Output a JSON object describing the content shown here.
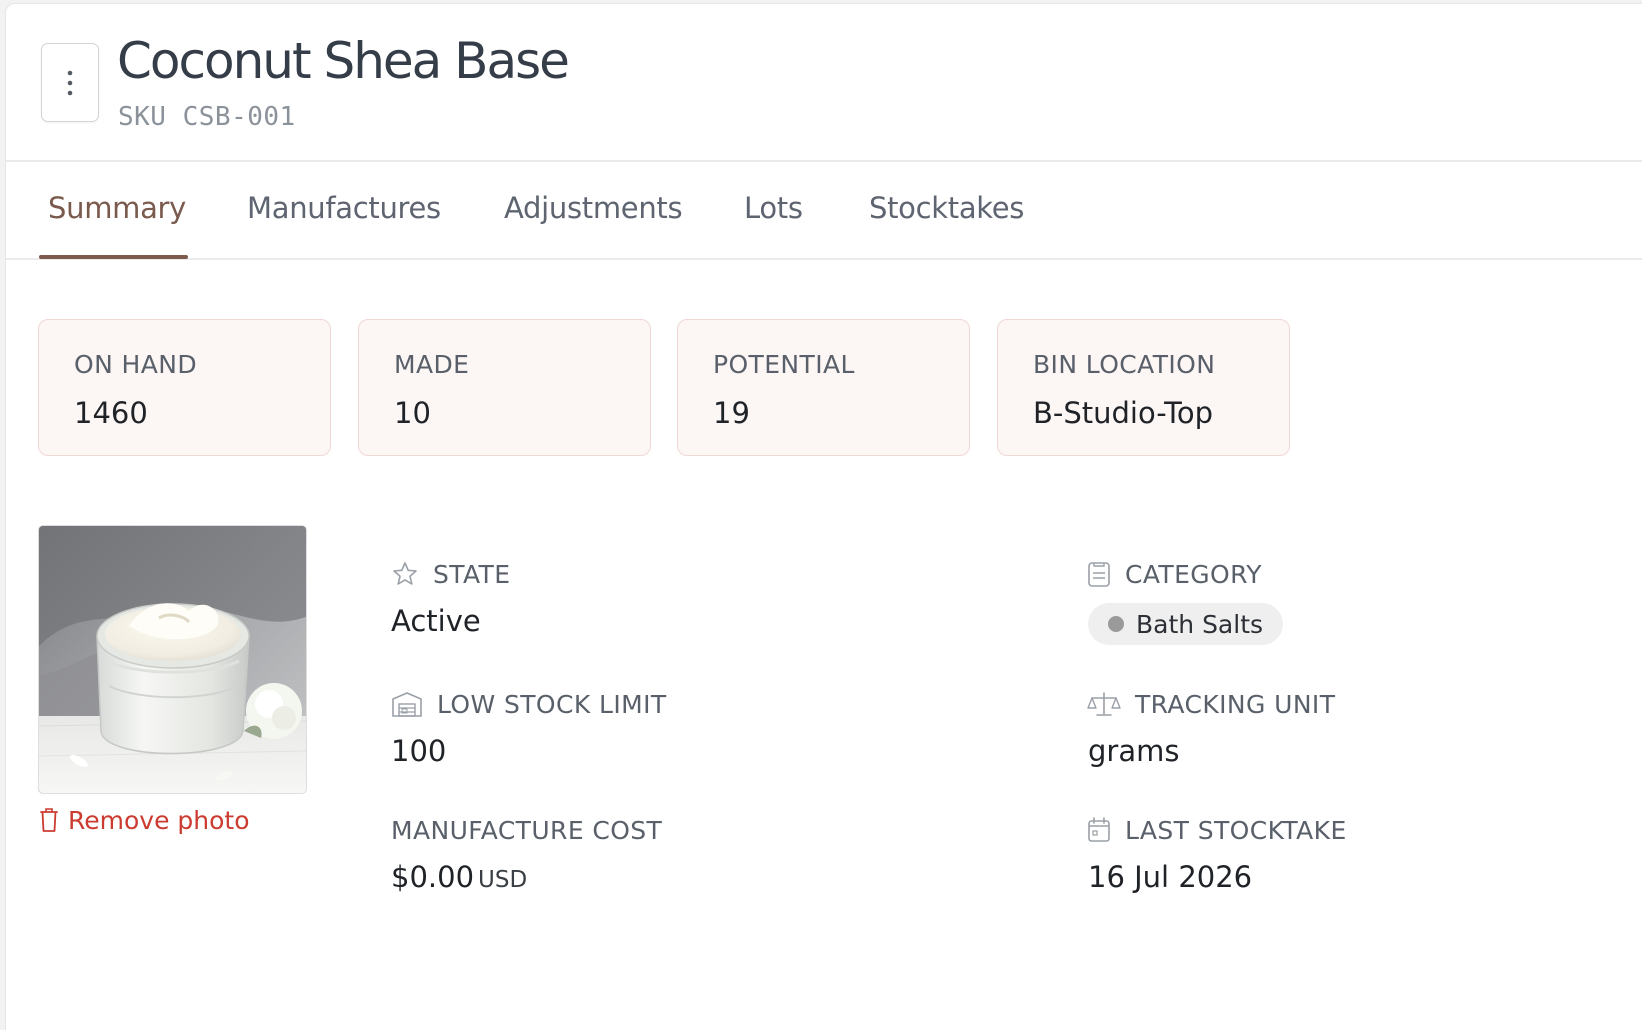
{
  "product": {
    "title": "Coconut Shea Base",
    "sku": "SKU CSB-001"
  },
  "tabs": [
    {
      "label": "Summary",
      "active": true
    },
    {
      "label": "Manufactures",
      "active": false
    },
    {
      "label": "Adjustments",
      "active": false
    },
    {
      "label": "Lots",
      "active": false
    },
    {
      "label": "Stocktakes",
      "active": false
    }
  ],
  "stats": [
    {
      "label": "ON HAND",
      "value": "1460"
    },
    {
      "label": "MADE",
      "value": "10"
    },
    {
      "label": "POTENTIAL",
      "value": "19"
    },
    {
      "label": "BIN LOCATION",
      "value": "B-Studio-Top"
    }
  ],
  "photo": {
    "remove_label": "Remove photo",
    "icon": "trash-icon"
  },
  "details": {
    "state": {
      "label": "STATE",
      "value": "Active",
      "icon": "star-icon"
    },
    "low_stock_limit": {
      "label": "LOW STOCK LIMIT",
      "value": "100",
      "icon": "warehouse-icon"
    },
    "manufacture_cost": {
      "label": "MANUFACTURE COST",
      "value": "$0.00",
      "currency": "USD"
    },
    "category": {
      "label": "CATEGORY",
      "value": "Bath Salts",
      "icon": "clipboard-icon"
    },
    "tracking_unit": {
      "label": "TRACKING UNIT",
      "value": "grams",
      "icon": "scale-icon"
    },
    "last_stocktake": {
      "label": "LAST STOCKTAKE",
      "value": "16 Jul 2026",
      "icon": "calendar-icon"
    }
  },
  "colors": {
    "accent": "#7d5a4c",
    "danger": "#cc3b30",
    "stat_bg": "#fcf6f4",
    "stat_border": "#f0d9d4"
  }
}
